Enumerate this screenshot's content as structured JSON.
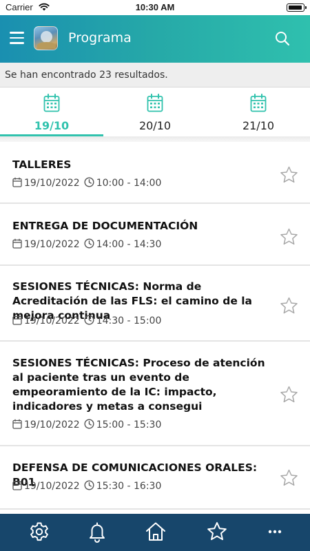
{
  "status_bar": {
    "carrier": "Carrier",
    "time": "10:30 AM"
  },
  "header": {
    "title": "Programa",
    "menu_icon": "hamburger-menu-icon",
    "search_icon": "search-icon",
    "gradient_start": "#1a8fb0",
    "gradient_end": "#2fc0ae"
  },
  "results": {
    "text": "Se han encontrado 23 resultados."
  },
  "tabs": [
    {
      "label": "19/10",
      "icon": "calendar-icon",
      "active": true
    },
    {
      "label": "20/10",
      "icon": "calendar-icon",
      "active": false
    },
    {
      "label": "21/10",
      "icon": "calendar-icon",
      "active": false
    }
  ],
  "events": [
    {
      "title": "TALLERES",
      "date": "19/10/2022",
      "time": "10:00 - 14:00"
    },
    {
      "title": "ENTREGA DE DOCUMENTACIÓN",
      "date": "19/10/2022",
      "time": "14:00 - 14:30"
    },
    {
      "title": "SESIONES TÉCNICAS: Norma de Acreditación de las FLS: el camino de la mejora continua",
      "date": "19/10/2022",
      "time": "14:30 - 15:00"
    },
    {
      "title": "SESIONES TÉCNICAS: Proceso de atención al paciente tras un evento de empeoramiento de la IC: impacto, indicadores y metas a consegui",
      "date": "19/10/2022",
      "time": "15:00 - 15:30"
    },
    {
      "title": "DEFENSA DE COMUNICACIONES ORALES: B01",
      "date": "19/10/2022",
      "time": "15:30 - 16:30"
    }
  ],
  "bottom_nav": [
    {
      "icon": "settings-gear-icon"
    },
    {
      "icon": "bell-icon"
    },
    {
      "icon": "home-icon"
    },
    {
      "icon": "star-icon"
    },
    {
      "icon": "more-dots-icon"
    }
  ],
  "colors": {
    "accent": "#30c2ad",
    "nav_background": "#17466b",
    "results_background": "#eeeeee"
  }
}
